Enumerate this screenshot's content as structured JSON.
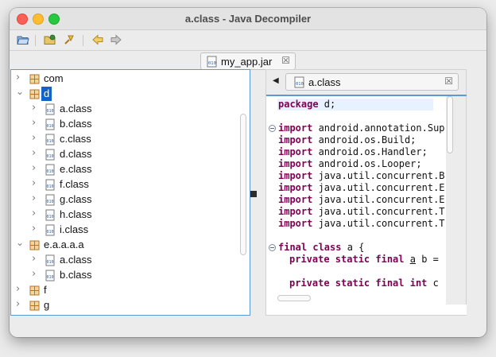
{
  "window": {
    "title": "a.class - Java Decompiler"
  },
  "toolbar": {
    "icons": [
      "open-file-icon",
      "open-type-icon",
      "search-icon",
      "back-arrow-icon",
      "forward-arrow-icon"
    ]
  },
  "file_tab": {
    "label": "my_app.jar"
  },
  "tree": {
    "items": [
      {
        "label": "com",
        "kind": "package",
        "expanded": false,
        "depth": 0
      },
      {
        "label": "d",
        "kind": "package",
        "expanded": true,
        "depth": 0,
        "selected": true
      },
      {
        "label": "a.class",
        "kind": "class",
        "depth": 1
      },
      {
        "label": "b.class",
        "kind": "class",
        "depth": 1
      },
      {
        "label": "c.class",
        "kind": "class",
        "depth": 1
      },
      {
        "label": "d.class",
        "kind": "class",
        "depth": 1
      },
      {
        "label": "e.class",
        "kind": "class",
        "depth": 1
      },
      {
        "label": "f.class",
        "kind": "class",
        "depth": 1
      },
      {
        "label": "g.class",
        "kind": "class",
        "depth": 1
      },
      {
        "label": "h.class",
        "kind": "class",
        "depth": 1
      },
      {
        "label": "i.class",
        "kind": "class",
        "depth": 1
      },
      {
        "label": "e.a.a.a.a",
        "kind": "package",
        "expanded": true,
        "depth": 0
      },
      {
        "label": "a.class",
        "kind": "class",
        "depth": 1
      },
      {
        "label": "b.class",
        "kind": "class",
        "depth": 1
      },
      {
        "label": "f",
        "kind": "package",
        "expanded": false,
        "depth": 0
      },
      {
        "label": "g",
        "kind": "package",
        "expanded": false,
        "depth": 0
      }
    ]
  },
  "editor": {
    "tab_label": "a.class",
    "code": {
      "l0_kw": "package",
      "l0_rest": " d;",
      "import_kw": "import",
      "i1": " android.annotation.Sup",
      "i2": " android.os.Build;",
      "i3": " android.os.Handler;",
      "i4": " android.os.Looper;",
      "i5": " java.util.concurrent.B",
      "i6": " java.util.concurrent.E",
      "i7": " java.util.concurrent.E",
      "i8": " java.util.concurrent.T",
      "i9": " java.util.concurrent.T",
      "c1_kw": "final class",
      "c1_rest": " a {",
      "f1_kw": "private static final",
      "f1_var": "a",
      "f1_rest": " b =",
      "f2_kw": "private static final int",
      "f2_rest": " c"
    }
  }
}
